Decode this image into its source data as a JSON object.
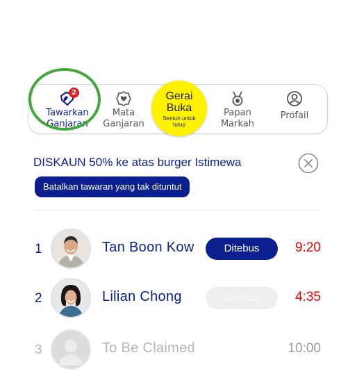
{
  "tabs": {
    "rewards_line1": "Tawarkan",
    "rewards_line2": "Ganjaran",
    "rewards_badge": "2",
    "points_line1": "Mata",
    "points_line2": "Ganjaran",
    "badges_line1": "Papan",
    "badges_line2": "Markah",
    "profile": "Profail"
  },
  "store": {
    "title_line1": "Gerai",
    "title_line2": "Buka",
    "sub_line1": "Sentuh untuk",
    "sub_line2": "tutup",
    "color": "#fff200"
  },
  "offer": {
    "title": "DISKAUN 50% ke atas burger Istimewa",
    "cancel_label": "Batalkan tawaran yang tak dituntut"
  },
  "claims": [
    {
      "rank": "1",
      "name": "Tan Boon Kow",
      "button": "Ditebus",
      "time": "9:20",
      "status": "active"
    },
    {
      "rank": "2",
      "name": "Lilian Chong",
      "button": "Ditebus",
      "time": "4:35",
      "status": "disabled"
    },
    {
      "rank": "3",
      "name": "To Be Claimed",
      "time": "10:00",
      "status": "pending"
    }
  ],
  "colors": {
    "accent": "#0b1f8f",
    "timer_red": "#e60000",
    "highlight_ring": "#42a83b",
    "badge_red": "#e02020"
  },
  "icons": [
    "tag-icon",
    "heart-badge-icon",
    "medal-icon",
    "user-icon",
    "close-icon",
    "avatar-photo",
    "avatar-placeholder-icon"
  ]
}
